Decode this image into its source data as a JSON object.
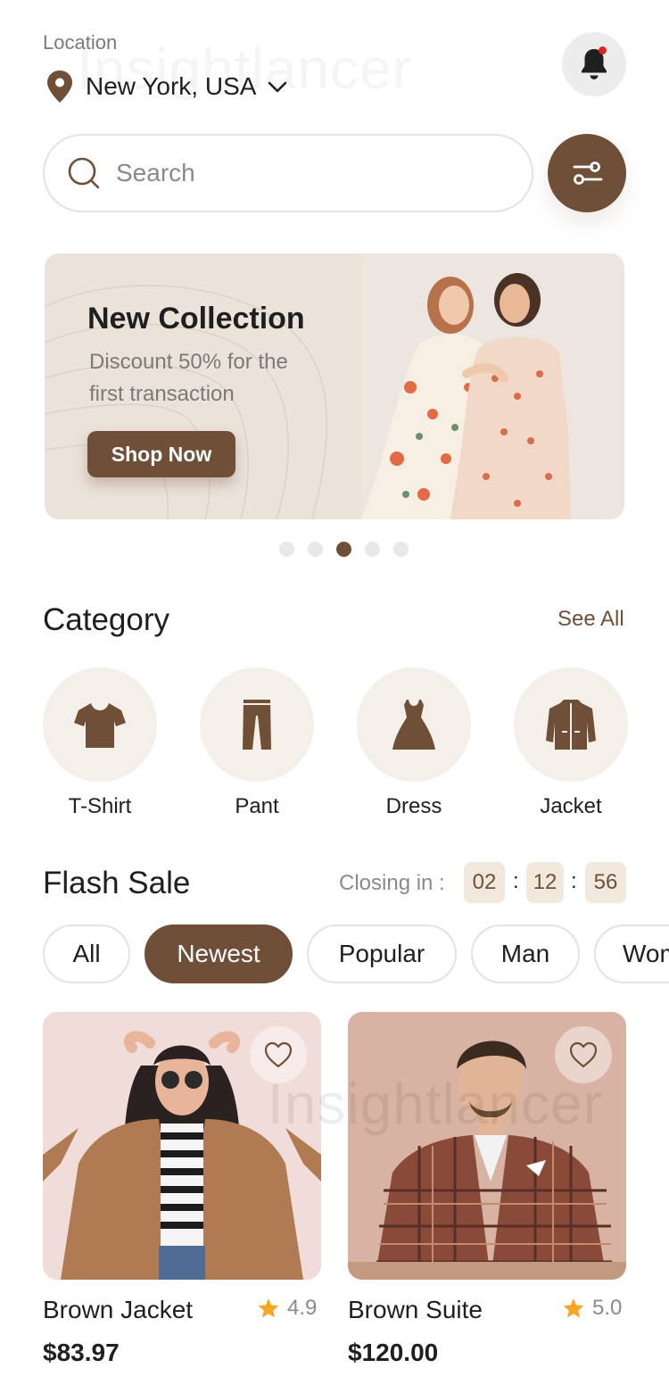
{
  "watermark": "Insightlancer",
  "header": {
    "location_label": "Location",
    "location_value": "New York, USA"
  },
  "search": {
    "placeholder": "Search"
  },
  "banner": {
    "title": "New Collection",
    "subtitle": "Discount 50% for the first transaction",
    "button": "Shop Now",
    "active_slide": 3,
    "slide_count": 5
  },
  "category": {
    "title": "Category",
    "see_all": "See All",
    "items": [
      {
        "label": "T-Shirt",
        "icon": "tshirt-icon"
      },
      {
        "label": "Pant",
        "icon": "pant-icon"
      },
      {
        "label": "Dress",
        "icon": "dress-icon"
      },
      {
        "label": "Jacket",
        "icon": "jacket-icon"
      }
    ]
  },
  "flash_sale": {
    "title": "Flash Sale",
    "closing_label": "Closing in :",
    "timer": [
      "02",
      "12",
      "56"
    ],
    "filters": [
      "All",
      "Newest",
      "Popular",
      "Man",
      "Woman"
    ],
    "active_filter": "Newest"
  },
  "products": [
    {
      "name": "Brown Jacket",
      "rating": "4.9",
      "price": "$83.97"
    },
    {
      "name": "Brown Suite",
      "rating": "5.0",
      "price": "$120.00"
    }
  ],
  "colors": {
    "brand": "#704f38",
    "star": "#f6a623",
    "chip_border": "#e3e3e3"
  }
}
